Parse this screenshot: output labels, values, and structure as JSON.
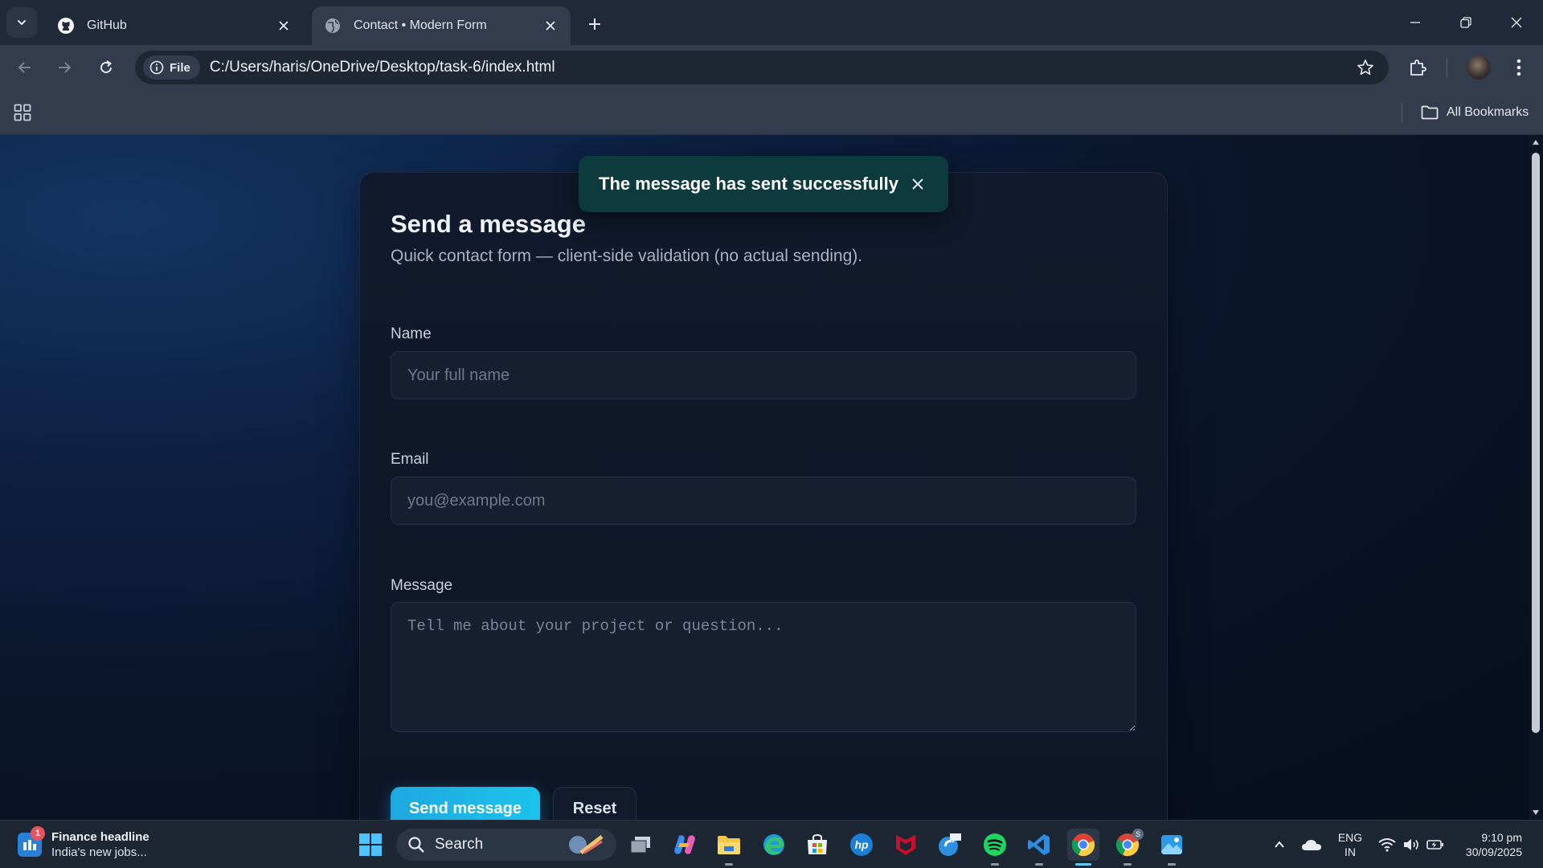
{
  "browser": {
    "tabs": [
      {
        "title": "GitHub",
        "icon": "github-icon",
        "active": false
      },
      {
        "title": "Contact • Modern Form",
        "icon": "globe-icon",
        "active": true
      }
    ],
    "site_chip": "File",
    "url": "C:/Users/haris/OneDrive/Desktop/task-6/index.html",
    "bookmarks_label": "All Bookmarks"
  },
  "toast": {
    "message": "The message has sent successfully",
    "color": "#0d3a3d"
  },
  "form": {
    "title": "Send a message",
    "subtitle": "Quick contact form — client-side validation (no actual sending).",
    "name_label": "Name",
    "name_placeholder": "Your full name",
    "email_label": "Email",
    "email_placeholder": "you@example.com",
    "message_label": "Message",
    "message_placeholder": "Tell me about your project or question...",
    "send_label": "Send message",
    "reset_label": "Reset",
    "accent": "#1fb4e6"
  },
  "taskbar": {
    "news_badge": "1",
    "news_headline": "Finance headline",
    "news_subtitle": "India's new jobs...",
    "search_label": "Search",
    "pinned": [
      "windows-start-icon",
      "task-view-icon",
      "copilot-icon",
      "file-explorer-icon",
      "edge-icon",
      "store-icon",
      "hp-icon",
      "mcafee-icon",
      "support-icon",
      "spotify-icon",
      "vscode-icon",
      "chrome-icon",
      "chrome-profile-icon",
      "photos-icon"
    ],
    "chrome_profile_badge": "S",
    "lang_line1": "ENG",
    "lang_line2": "IN",
    "time": "9:10 pm",
    "date": "30/09/2025"
  }
}
